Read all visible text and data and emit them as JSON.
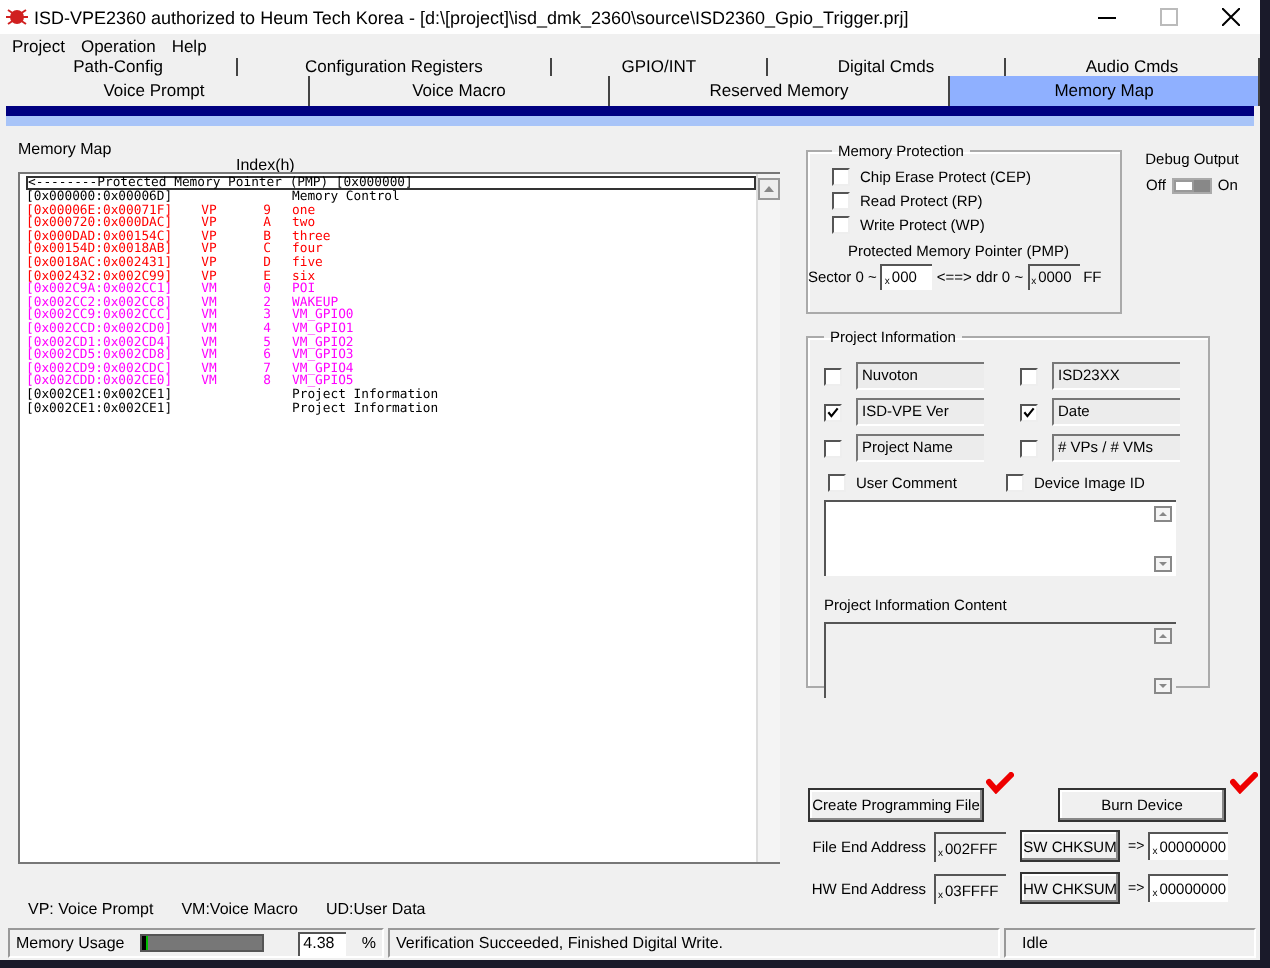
{
  "window": {
    "title": "ISD-VPE2360 authorized to Heum Tech Korea - [d:\\[project]\\isd_dmk_2360\\source\\ISD2360_Gpio_Trigger.prj]"
  },
  "menu": [
    "Project",
    "Operation",
    "Help"
  ],
  "tab_rows": [
    [
      {
        "label": "Path-Config",
        "selected": false
      },
      {
        "label": "Configuration Registers",
        "selected": false
      },
      {
        "label": "GPIO/INT",
        "selected": false
      },
      {
        "label": "Digital Cmds",
        "selected": false
      },
      {
        "label": "Audio Cmds",
        "selected": false
      }
    ],
    [
      {
        "label": "Voice Prompt",
        "selected": false
      },
      {
        "label": "Voice Macro",
        "selected": false
      },
      {
        "label": "Reserved Memory",
        "selected": false
      },
      {
        "label": "Memory Map",
        "selected": true
      }
    ]
  ],
  "memory_map": {
    "label": "Memory Map",
    "index_header": "Index(h)",
    "header": "<--------Protected Memory Pointer (PMP) [0x000000]",
    "rows": [
      {
        "range": "[0x000000:0x00006D]",
        "name": "Memory Control",
        "color": "#000000"
      },
      {
        "range": "[0x00006E:0x00071F]",
        "type": "VP",
        "index": "9",
        "name": "one",
        "color": "#ff0000"
      },
      {
        "range": "[0x000720:0x000DAC]",
        "type": "VP",
        "index": "A",
        "name": "two",
        "color": "#ff0000"
      },
      {
        "range": "[0x000DAD:0x00154C]",
        "type": "VP",
        "index": "B",
        "name": "three",
        "color": "#ff0000"
      },
      {
        "range": "[0x00154D:0x0018AB]",
        "type": "VP",
        "index": "C",
        "name": "four",
        "color": "#ff0000"
      },
      {
        "range": "[0x0018AC:0x002431]",
        "type": "VP",
        "index": "D",
        "name": "five",
        "color": "#ff0000"
      },
      {
        "range": "[0x002432:0x002C99]",
        "type": "VP",
        "index": "E",
        "name": "six",
        "color": "#ff0000"
      },
      {
        "range": "[0x002C9A:0x002CC1]",
        "type": "VM",
        "index": "0",
        "name": "POI",
        "color": "#ff00ff"
      },
      {
        "range": "[0x002CC2:0x002CC8]",
        "type": "VM",
        "index": "2",
        "name": "WAKEUP",
        "color": "#ff00ff"
      },
      {
        "range": "[0x002CC9:0x002CCC]",
        "type": "VM",
        "index": "3",
        "name": "VM_GPIO0",
        "color": "#ff00ff"
      },
      {
        "range": "[0x002CCD:0x002CD0]",
        "type": "VM",
        "index": "4",
        "name": "VM_GPIO1",
        "color": "#ff00ff"
      },
      {
        "range": "[0x002CD1:0x002CD4]",
        "type": "VM",
        "index": "5",
        "name": "VM_GPIO2",
        "color": "#ff00ff"
      },
      {
        "range": "[0x002CD5:0x002CD8]",
        "type": "VM",
        "index": "6",
        "name": "VM_GPIO3",
        "color": "#ff00ff"
      },
      {
        "range": "[0x002CD9:0x002CDC]",
        "type": "VM",
        "index": "7",
        "name": "VM_GPIO4",
        "color": "#ff00ff"
      },
      {
        "range": "[0x002CDD:0x002CE0]",
        "type": "VM",
        "index": "8",
        "name": "VM_GPIO5",
        "color": "#ff00ff"
      },
      {
        "range": "[0x002CE1:0x002CE1]",
        "name": "Project Information",
        "color": "#000000"
      },
      {
        "range": "[0x002CE1:0x002CE1]",
        "name": "Project Information",
        "color": "#000000"
      }
    ]
  },
  "legend": [
    "VP: Voice Prompt",
    "VM:Voice Macro",
    "UD:User Data"
  ],
  "memory_protection": {
    "title": "Memory Protection",
    "options": [
      {
        "label": "Chip Erase Protect (CEP)",
        "checked": false
      },
      {
        "label": "Read Protect (RP)",
        "checked": false
      },
      {
        "label": "Write Protect (WP)",
        "checked": false
      }
    ],
    "pmp_label": "Protected Memory Pointer (PMP)",
    "sector_label": "Sector 0 ~",
    "sector": {
      "prefix": "x",
      "value": "000"
    },
    "between": "<==> ddr 0 ~",
    "address": {
      "prefix": "x",
      "value": "0000"
    },
    "suffix": "FF"
  },
  "debug_output": {
    "label": "Debug Output",
    "off_label": "Off",
    "on_label": "On",
    "on": false
  },
  "project_information": {
    "title": "Project Information",
    "fields": [
      {
        "value": "Nuvoton",
        "checked": false
      },
      {
        "value": "ISD23XX",
        "checked": false
      },
      {
        "value": "ISD-VPE Ver",
        "checked": true
      },
      {
        "value": "Date",
        "checked": true
      },
      {
        "value": "Project Name",
        "checked": false
      },
      {
        "value": "# VPs / # VMs",
        "checked": false
      }
    ],
    "options": [
      {
        "label": "User Comment",
        "checked": false
      },
      {
        "label": "Device Image ID",
        "checked": false
      }
    ],
    "content_label": "Project Information Content"
  },
  "buttons": [
    "Create Programming File",
    "Burn Device"
  ],
  "addresses": [
    {
      "label": "File End Address",
      "prefix": "x",
      "value": "002FFF",
      "button": "SW CHKSUM",
      "arrow": "=>",
      "result_prefix": "x",
      "result": "00000000"
    },
    {
      "label": "HW End Address",
      "prefix": "x",
      "value": "03FFFF",
      "button": "HW CHKSUM",
      "arrow": "=>",
      "result_prefix": "x",
      "result": "00000000"
    }
  ],
  "status_bar": {
    "memory_usage_label": "Memory Usage",
    "level": 0.04,
    "percent": "4.38",
    "percent_sign": "%",
    "message": "Verification Succeeded, Finished Digital Write.",
    "state": "Idle"
  }
}
